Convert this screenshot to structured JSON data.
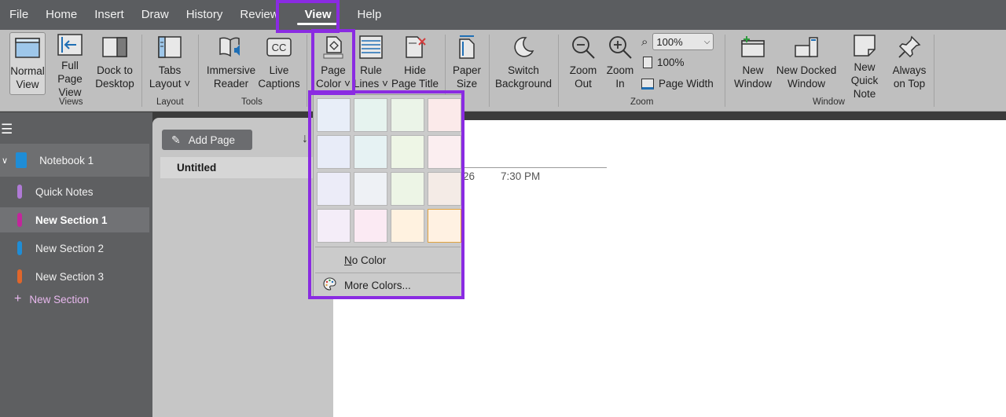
{
  "menu": {
    "file": "File",
    "home": "Home",
    "insert": "Insert",
    "draw": "Draw",
    "history": "History",
    "review": "Review",
    "view": "View",
    "help": "Help"
  },
  "ribbon": {
    "normal_view": [
      "Normal",
      "View"
    ],
    "full_page_view": [
      "Full Page",
      "View"
    ],
    "dock_to_desktop": [
      "Dock to",
      "Desktop"
    ],
    "views_label": "Views",
    "tabs_layout": [
      "Tabs",
      "Layout ˅"
    ],
    "layout_label": "Layout",
    "immersive_reader": [
      "Immersive",
      "Reader"
    ],
    "live_captions": [
      "Live",
      "Captions"
    ],
    "tools_label": "Tools",
    "page_color": [
      "Page",
      "Color ˅"
    ],
    "rule_lines": [
      "Rule",
      "Lines ˅"
    ],
    "hide_page_title": [
      "Hide",
      "Page Title"
    ],
    "paper_size": [
      "Paper",
      "Size"
    ],
    "switch_background": [
      "Switch",
      "Background"
    ],
    "zoom_out": [
      "Zoom",
      "Out"
    ],
    "zoom_in": [
      "Zoom",
      "In"
    ],
    "zoom_value": "100%",
    "zoom_100": "100%",
    "page_width": "Page Width",
    "zoom_label": "Zoom",
    "new_window": [
      "New",
      "Window"
    ],
    "new_docked_window": [
      "New Docked",
      "Window"
    ],
    "new_quick_note": [
      "New Quick",
      "Note"
    ],
    "always_on_top": [
      "Always",
      "on Top"
    ],
    "window_label": "Window"
  },
  "nav": {
    "notebook": "Notebook 1",
    "sections": [
      {
        "label": "Quick Notes",
        "color": "#b07ad6"
      },
      {
        "label": "New Section 1",
        "color": "#c2269c"
      },
      {
        "label": "New Section 2",
        "color": "#1f8dd6"
      },
      {
        "label": "New Section 3",
        "color": "#e0662b"
      }
    ],
    "add_section": "New Section"
  },
  "pages": {
    "add_page": "Add Page",
    "items": [
      "Untitled"
    ]
  },
  "canvas": {
    "date_fragment": "26",
    "time": "7:30 PM"
  },
  "page_color_menu": {
    "swatches": [
      [
        "#e8eef8",
        "#e6f3ef",
        "#ebf4e8",
        "#fbeaea"
      ],
      [
        "#e8ecf8",
        "#e6f2f3",
        "#eef6e6",
        "#fbeef0"
      ],
      [
        "#ececf8",
        "#eef1f5",
        "#edf5e6",
        "#f4ebe6"
      ],
      [
        "#f4edf8",
        "#fbeaf3",
        "#fff2e0",
        "#fff1e2"
      ]
    ],
    "no_color": "No Color",
    "more_colors": "More Colors..."
  }
}
